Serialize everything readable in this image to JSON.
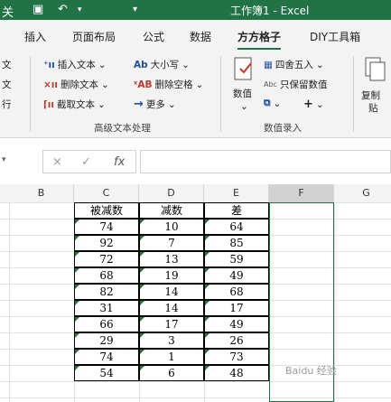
{
  "app": {
    "title": "工作簿1 - Excel"
  },
  "quick_access": {
    "autosave_label": "关",
    "save_icon": "save-icon",
    "undo_icon": "undo-icon",
    "more_icon": "more-icon"
  },
  "tabs": [
    "插入",
    "页面布局",
    "公式",
    "数据",
    "方方格子",
    "DIY工具箱"
  ],
  "active_tab": "方方格子",
  "ribbon": {
    "left_partial": [
      "文",
      "文",
      "行"
    ],
    "text_group": {
      "insert_text": "插入文本",
      "delete_text": "删除文本",
      "extract_text": "截取文本",
      "case": "大小写",
      "delete_spaces": "删除空格",
      "more": "更多",
      "label": "高级文本处理"
    },
    "number_group": {
      "numeric": "数值",
      "round": "四舍五入",
      "keep_values": "只保留数值",
      "plus": "+",
      "label": "数值录入"
    },
    "copy_group": {
      "label1": "复制",
      "label2": "贴"
    }
  },
  "formula_bar": {
    "name_box": "",
    "fx": "fx",
    "cancel": "×",
    "confirm": "✓",
    "value": ""
  },
  "columns": [
    "B",
    "C",
    "D",
    "E",
    "F",
    "G"
  ],
  "selected_column": "F",
  "table": {
    "headers": [
      "被减数",
      "减数",
      "差"
    ],
    "rows": [
      [
        "74",
        "10",
        "64"
      ],
      [
        "92",
        "7",
        "85"
      ],
      [
        "72",
        "13",
        "59"
      ],
      [
        "68",
        "19",
        "49"
      ],
      [
        "82",
        "14",
        "68"
      ],
      [
        "31",
        "14",
        "17"
      ],
      [
        "66",
        "17",
        "49"
      ],
      [
        "29",
        "3",
        "26"
      ],
      [
        "74",
        "1",
        "73"
      ],
      [
        "54",
        "6",
        "48"
      ]
    ]
  },
  "watermark": "Baidu 经验"
}
